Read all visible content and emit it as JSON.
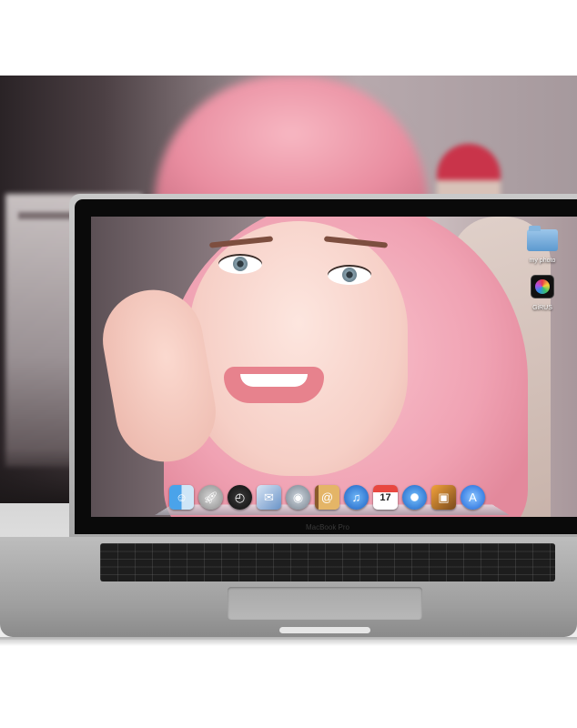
{
  "desktop": {
    "icons": [
      {
        "label": "my photo",
        "icon": "folder-icon"
      },
      {
        "label": "GiRUS",
        "icon": "app-icon"
      }
    ]
  },
  "dock": {
    "items": [
      {
        "name": "finder",
        "icon": "finder-icon"
      },
      {
        "name": "launchpad",
        "icon": "rocket-icon"
      },
      {
        "name": "dashboard",
        "icon": "gauge-icon"
      },
      {
        "name": "mail",
        "icon": "mail-icon"
      },
      {
        "name": "facetime",
        "icon": "camera-icon"
      },
      {
        "name": "address-book",
        "icon": "contacts-icon"
      },
      {
        "name": "itunes",
        "icon": "music-icon"
      },
      {
        "name": "calendar",
        "icon": "calendar-icon",
        "day": "17"
      },
      {
        "name": "safari",
        "icon": "compass-icon"
      },
      {
        "name": "iphoto",
        "icon": "photos-icon"
      },
      {
        "name": "app-store",
        "icon": "appstore-icon"
      }
    ]
  },
  "device": {
    "brand_label": "MacBook Pro"
  }
}
